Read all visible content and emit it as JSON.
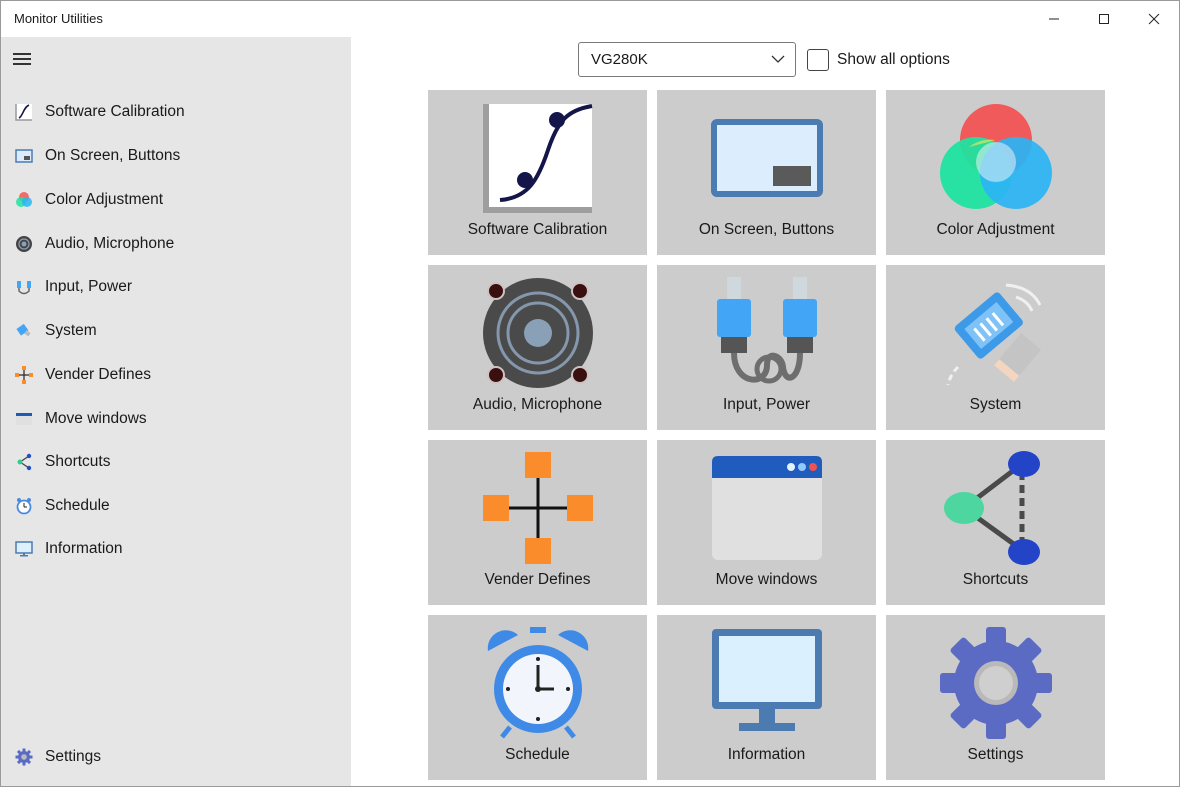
{
  "window": {
    "title": "Monitor Utilities"
  },
  "toolbar": {
    "monitor_selected": "VG280K",
    "show_all_label": "Show all options",
    "show_all_checked": false
  },
  "sidebar": {
    "items": [
      {
        "label": "Software Calibration",
        "icon": "calibration-icon"
      },
      {
        "label": "On Screen, Buttons",
        "icon": "on-screen-icon"
      },
      {
        "label": "Color Adjustment",
        "icon": "color-icon"
      },
      {
        "label": "Audio, Microphone",
        "icon": "speaker-icon"
      },
      {
        "label": "Input, Power",
        "icon": "cable-icon"
      },
      {
        "label": "System",
        "icon": "system-icon"
      },
      {
        "label": "Vender Defines",
        "icon": "vender-icon"
      },
      {
        "label": "Move windows",
        "icon": "window-icon"
      },
      {
        "label": "Shortcuts",
        "icon": "share-icon"
      },
      {
        "label": "Schedule",
        "icon": "alarm-clock-icon"
      },
      {
        "label": "Information",
        "icon": "monitor-icon"
      }
    ],
    "settings_label": "Settings"
  },
  "tiles": [
    {
      "label": "Software Calibration",
      "icon": "calibration-icon"
    },
    {
      "label": "On Screen, Buttons",
      "icon": "on-screen-icon"
    },
    {
      "label": "Color Adjustment",
      "icon": "color-icon"
    },
    {
      "label": "Audio, Microphone",
      "icon": "speaker-icon"
    },
    {
      "label": "Input, Power",
      "icon": "cable-icon"
    },
    {
      "label": "System",
      "icon": "system-icon"
    },
    {
      "label": "Vender Defines",
      "icon": "vender-icon"
    },
    {
      "label": "Move windows",
      "icon": "window-icon"
    },
    {
      "label": "Shortcuts",
      "icon": "share-icon"
    },
    {
      "label": "Schedule",
      "icon": "alarm-clock-icon"
    },
    {
      "label": "Information",
      "icon": "monitor-icon"
    },
    {
      "label": "Settings",
      "icon": "gear-icon"
    }
  ],
  "colors": {
    "sidebar_bg": "#e6e6e6",
    "tile_bg": "#cccccc",
    "accent_orange": "#fb8c2c",
    "accent_blue": "#4b7bb0"
  }
}
